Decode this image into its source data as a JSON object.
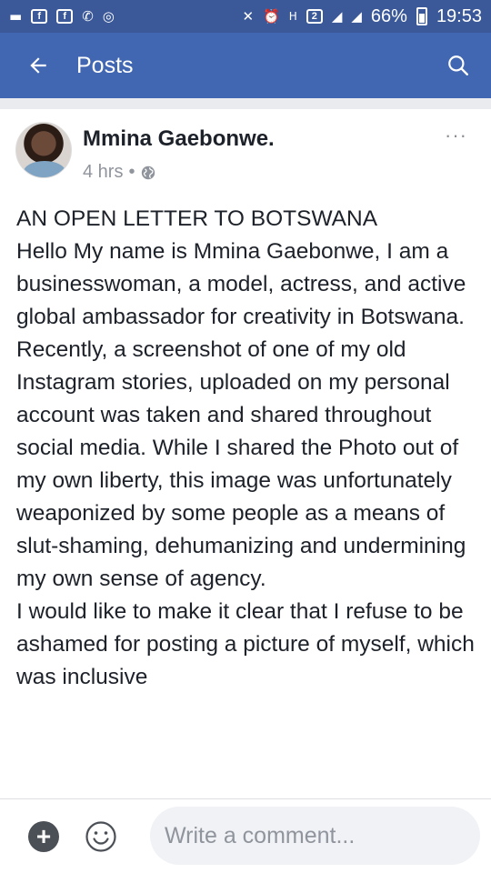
{
  "status_bar": {
    "battery": "66%",
    "time": "19:53",
    "network_badge": "2",
    "network_small": "H",
    "icons": [
      "messages-icon",
      "facebook-icon",
      "facebook-icon",
      "whatsapp-icon",
      "sync-icon",
      "mute-icon",
      "alarm-icon",
      "signal-icon",
      "signal-icon",
      "battery-icon"
    ]
  },
  "app_bar": {
    "title": "Posts",
    "back_icon": "arrow-left-icon",
    "search_icon": "search-icon"
  },
  "post": {
    "author": "Mmina Gaebonwe.",
    "time": "4 hrs",
    "separator": "•",
    "privacy_icon": "globe-icon",
    "more": "···",
    "body": "AN OPEN LETTER TO BOTSWANA\nHello My name is Mmina Gaebonwe, I am a businesswoman, a model, actress, and active global ambassador for creativity in Botswana.\nRecently, a screenshot of one of my old Instagram stories, uploaded on my personal account was taken and shared throughout social media. While I shared the Photo out of my own liberty, this image was unfortunately weaponized by some people as a means of slut-shaming, dehumanizing and undermining my own sense of agency.\nI would like to make it clear that I refuse to be ashamed for posting a picture of myself, which was inclusive"
  },
  "comment_bar": {
    "add_label": "+",
    "placeholder": "Write a comment..."
  },
  "colors": {
    "status_bar": "#3b5998",
    "app_bar": "#4267b2",
    "text": "#1d2129",
    "meta": "#90949c"
  }
}
